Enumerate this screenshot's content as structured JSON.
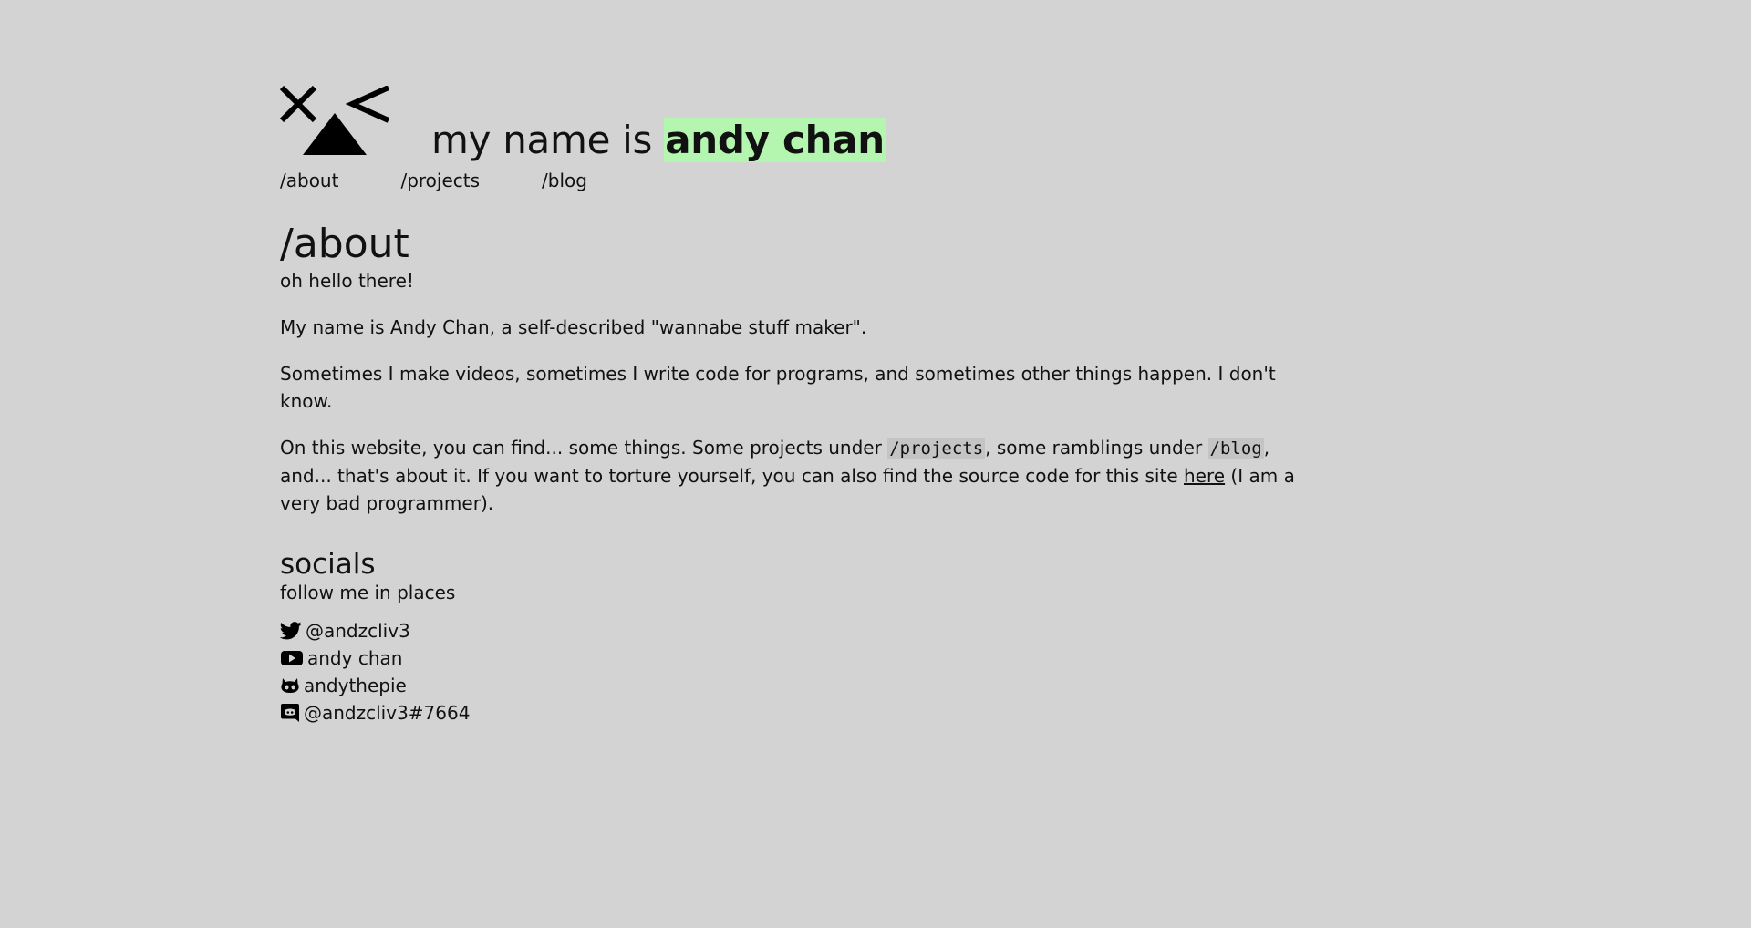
{
  "header": {
    "title_prefix": "my name is ",
    "title_name": "andy chan",
    "logo_icon": "squinting-face-logo",
    "highlight_color": "#b4f5b0"
  },
  "nav": [
    {
      "label": "/about"
    },
    {
      "label": "/projects"
    },
    {
      "label": "/blog"
    }
  ],
  "main": {
    "heading": "/about",
    "greeting": "oh hello there!",
    "intro": "My name is Andy Chan, a self-described \"wannabe stuff maker\".",
    "description": "Sometimes I make videos, sometimes I write code for programs, and sometimes other things happen. I don't know.",
    "site_info": {
      "part1": "On this website, you can find... some things. Some projects under ",
      "code_projects": "/projects",
      "part2": ", some ramblings under ",
      "code_blog": "/blog",
      "part3": ", and... that's about it. If you want to torture yourself, you can also find the source code for this site ",
      "link_here": "here",
      "part4": " (I am a very bad programmer)."
    }
  },
  "socials": {
    "heading": "socials",
    "subtitle": "follow me in places",
    "items": [
      {
        "icon": "twitter-icon",
        "label": "@andzcliv3"
      },
      {
        "icon": "youtube-icon",
        "label": "andy chan"
      },
      {
        "icon": "github-icon",
        "label": "andythepie"
      },
      {
        "icon": "discord-icon",
        "label": "@andzcliv3#7664"
      }
    ]
  },
  "colors": {
    "background": "#d3d3d3",
    "text": "#111111",
    "code_background": "#c4c4c4"
  }
}
